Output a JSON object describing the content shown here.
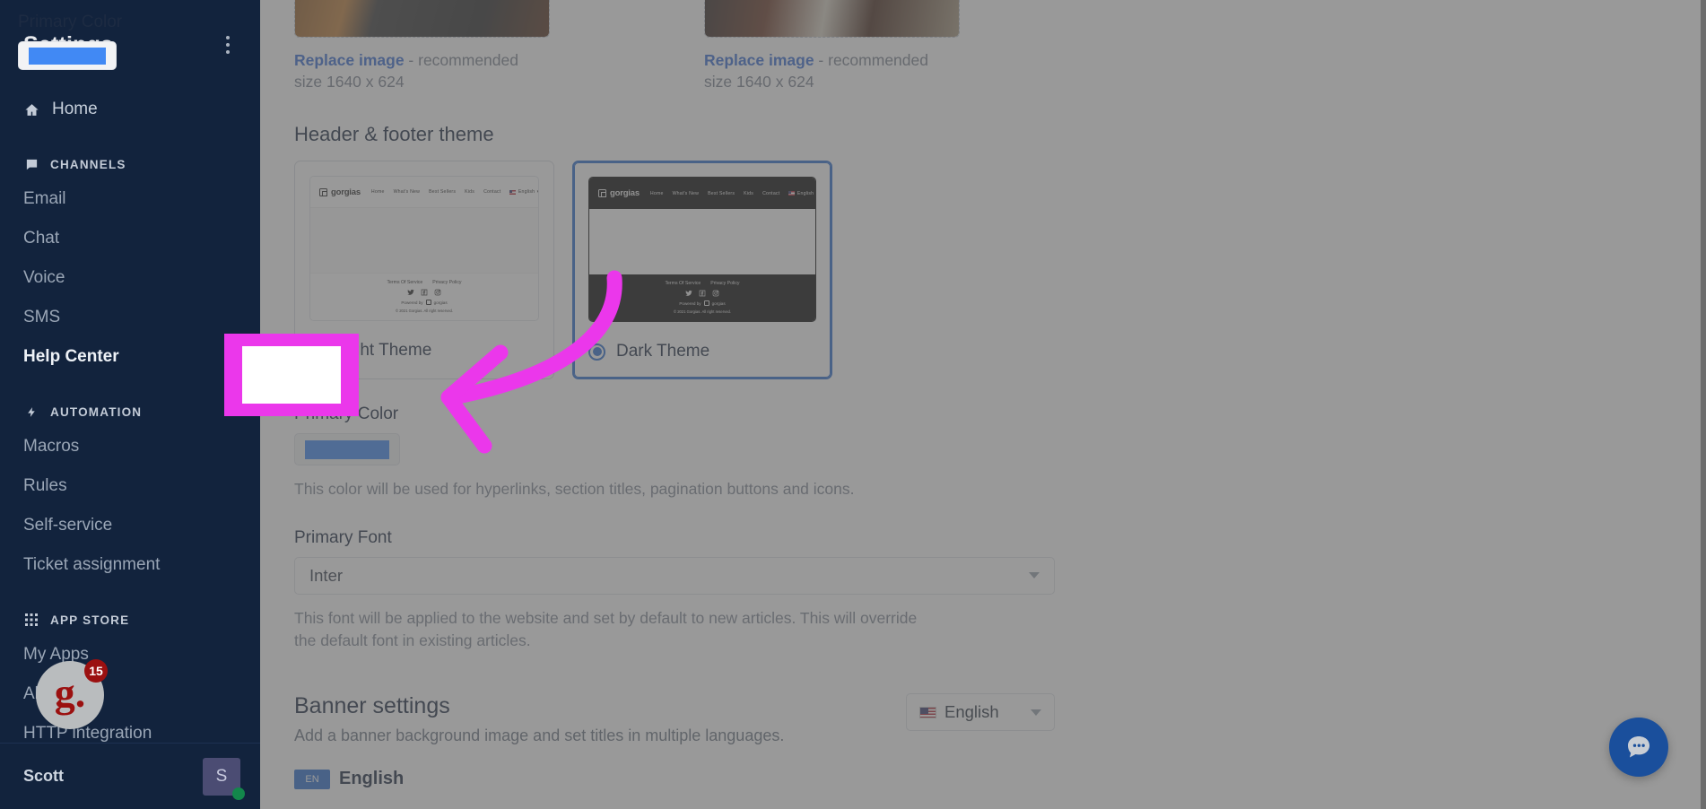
{
  "sidebar": {
    "title": "Settings",
    "menu_icon": "kebab-menu-icon",
    "home": {
      "label": "Home",
      "icon": "home-icon"
    },
    "sections": [
      {
        "label": "CHANNELS",
        "icon": "chat-bubble-icon",
        "items": [
          {
            "label": "Email",
            "active": false
          },
          {
            "label": "Chat",
            "active": false
          },
          {
            "label": "Voice",
            "active": false
          },
          {
            "label": "SMS",
            "active": false
          },
          {
            "label": "Help Center",
            "active": true
          }
        ]
      },
      {
        "label": "AUTOMATION",
        "icon": "lightning-bolt-icon",
        "items": [
          {
            "label": "Macros",
            "active": false
          },
          {
            "label": "Rules",
            "active": false
          },
          {
            "label": "Self-service",
            "active": false
          },
          {
            "label": "Ticket assignment",
            "active": false
          }
        ]
      },
      {
        "label": "APP STORE",
        "icon": "grid-apps-icon",
        "items": [
          {
            "label": "My Apps",
            "active": false
          },
          {
            "label": "All Apps",
            "active": false
          },
          {
            "label": "HTTP integration",
            "active": false
          }
        ]
      }
    ],
    "user": {
      "name": "Scott",
      "avatar_initial": "S",
      "presence": "online"
    }
  },
  "gorgias_widget": {
    "logo_text": "g.",
    "unread_count": "15"
  },
  "chat_launcher": {
    "icon": "chat-dots-icon",
    "color": "#1a4f9c"
  },
  "main": {
    "images": [
      {
        "replace_label": "Replace image",
        "recommend_text": " - recommended size 1640 x 624"
      },
      {
        "replace_label": "Replace image",
        "recommend_text": " - recommended size 1640 x 624"
      }
    ],
    "theme_section": {
      "title": "Header & footer theme",
      "preview": {
        "brand": "gorgias",
        "nav": [
          "Home",
          "What's New",
          "Best Sellers",
          "Kids",
          "Contact"
        ],
        "language": "English",
        "footer_links": [
          "Terms Of Service",
          "Privacy Policy"
        ],
        "socials": [
          "twitter-icon",
          "facebook-icon",
          "instagram-icon"
        ],
        "powered_by": "Powered by",
        "powered_brand": "gorgias",
        "copyright": "© 2021 Gorgias. All right reserved."
      },
      "options": [
        {
          "label": "Light Theme",
          "selected": false
        },
        {
          "label": "Dark Theme",
          "selected": true
        }
      ]
    },
    "primary_color": {
      "label": "Primary Color",
      "value": "#4189f4",
      "help": "This color will be used for hyperlinks, section titles, pagination buttons and icons."
    },
    "primary_font": {
      "label": "Primary Font",
      "value": "Inter",
      "help": "This font will be applied to the website and set by default to new articles. This will override the default font in existing articles."
    },
    "banner_settings": {
      "title": "Banner settings",
      "subtitle": "Add a banner background image and set titles in multiple languages.",
      "language": "English",
      "chip_badge": "EN",
      "chip_label": "English"
    }
  },
  "annotation": {
    "highlight_color": "#eb37eb",
    "arrow_icon": "curved-left-arrow-annotation"
  },
  "colors": {
    "sidebar_bg": "#12233d",
    "accent_blue": "#2f6fd0",
    "link_blue": "#3b6fd4",
    "swatch_blue": "#4189f4",
    "magenta": "#eb37eb"
  }
}
